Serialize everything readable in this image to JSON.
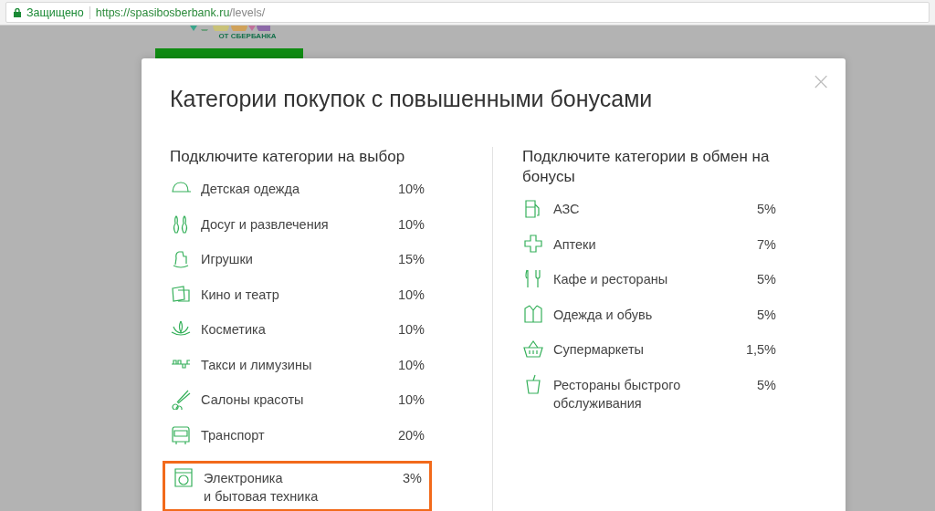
{
  "browser": {
    "secure_label": "Защищено",
    "url_host": "https://spasibosberbank.ru",
    "url_path": "/levels/"
  },
  "background": {
    "logo_caption": "ОТ СБЕРБАНКА"
  },
  "modal": {
    "title": "Категории покупок с повышенными бонусами",
    "close": "×",
    "columns": [
      {
        "heading": "Подключите категории на выбор",
        "items": [
          {
            "label": "Детская одежда",
            "percent": "10%",
            "highlighted": false
          },
          {
            "label": "Досуг и развлечения",
            "percent": "10%",
            "highlighted": false
          },
          {
            "label": "Игрушки",
            "percent": "15%",
            "highlighted": false
          },
          {
            "label": "Кино и театр",
            "percent": "10%",
            "highlighted": false
          },
          {
            "label": "Косметика",
            "percent": "10%",
            "highlighted": false
          },
          {
            "label": "Такси и лимузины",
            "percent": "10%",
            "highlighted": false
          },
          {
            "label": "Салоны красоты",
            "percent": "10%",
            "highlighted": false
          },
          {
            "label": "Транспорт",
            "percent": "20%",
            "highlighted": false
          },
          {
            "label": "Электроника\nи бытовая техника",
            "percent": "3%",
            "highlighted": true
          }
        ]
      },
      {
        "heading": "Подключите категории в обмен на бонусы",
        "items": [
          {
            "label": "АЗС",
            "percent": "5%",
            "highlighted": false
          },
          {
            "label": "Аптеки",
            "percent": "7%",
            "highlighted": false
          },
          {
            "label": "Кафе и рестораны",
            "percent": "5%",
            "highlighted": false
          },
          {
            "label": "Одежда и обувь",
            "percent": "5%",
            "highlighted": false
          },
          {
            "label": "Супермаркеты",
            "percent": "1,5%",
            "highlighted": false
          },
          {
            "label": "Рестораны быстрого\nобслуживания",
            "percent": "5%",
            "highlighted": false
          }
        ]
      }
    ]
  }
}
